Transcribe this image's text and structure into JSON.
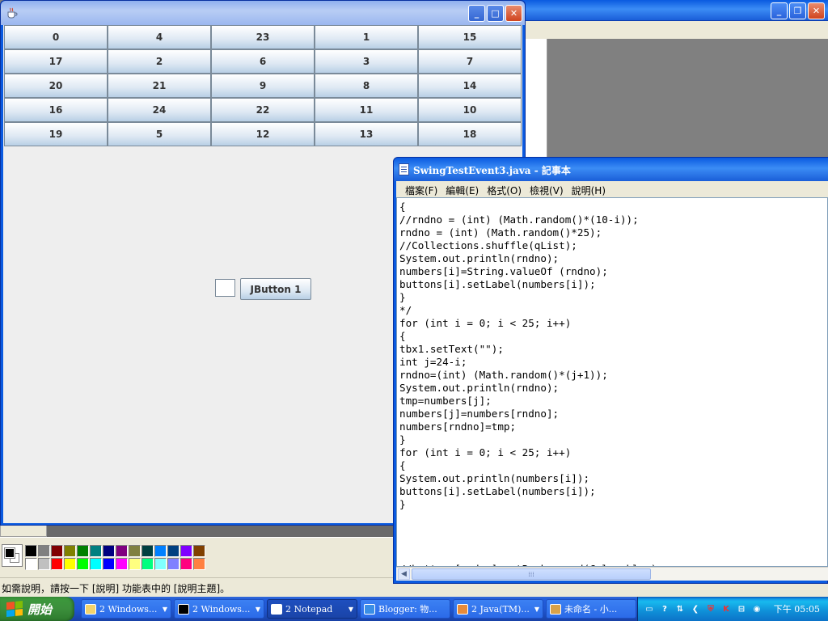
{
  "java_window": {
    "grid_labels": [
      "0",
      "4",
      "23",
      "1",
      "15",
      "17",
      "2",
      "6",
      "3",
      "7",
      "20",
      "21",
      "9",
      "8",
      "14",
      "16",
      "24",
      "22",
      "11",
      "10",
      "19",
      "5",
      "12",
      "13",
      "18"
    ],
    "textbox_value": "",
    "jbutton_label": "JButton 1"
  },
  "notepad": {
    "title": "SwingTestEvent3.java - 記事本",
    "menu": [
      "檔案(F)",
      "編輯(E)",
      "格式(O)",
      "檢視(V)",
      "說明(H)"
    ],
    "code_lines": [
      "{",
      "//rndno = (int) (Math.random()*(10-i));",
      "rndno = (int) (Math.random()*25);",
      "//Collections.shuffle(qList);",
      "System.out.println(rndno);",
      "numbers[i]=String.valueOf (rndno);",
      "buttons[i].setLabel(numbers[i]);",
      "}",
      "*/",
      "for (int i = 0; i < 25; i++)",
      "{",
      "tbx1.setText(\"\");",
      "int j=24-i;",
      "rndno=(int) (Math.random()*(j+1));",
      "System.out.println(rndno);",
      "tmp=numbers[j];",
      "numbers[j]=numbers[rndno];",
      "numbers[rndno]=tmp;",
      "}",
      "for (int i = 0; i < 25; i++)",
      "{",
      "System.out.println(numbers[i]);",
      "buttons[i].setLabel(numbers[i]);",
      "}",
      "",
      "",
      "",
      "",
      "//buttons[rndno].setBackground(Color.blue);"
    ]
  },
  "paint": {
    "status_text": "如需說明，請按一下 [說明] 功能表中的 [說明主題]。",
    "palette_top": [
      "#000000",
      "#808080",
      "#800000",
      "#808000",
      "#008000",
      "#008080",
      "#000080",
      "#800080",
      "#808040",
      "#004040",
      "#0080ff",
      "#004080",
      "#8000ff",
      "#804000"
    ],
    "palette_bottom": [
      "#ffffff",
      "#c0c0c0",
      "#ff0000",
      "#ffff00",
      "#00ff00",
      "#00ffff",
      "#0000ff",
      "#ff00ff",
      "#ffff80",
      "#00ff80",
      "#80ffff",
      "#8080ff",
      "#ff0080",
      "#ff8040"
    ]
  },
  "taskbar": {
    "start_label": "開始",
    "tasks": [
      {
        "label": "2 Windows...",
        "icon": "folder-icon",
        "active": false
      },
      {
        "label": "2 Windows...",
        "icon": "cmd-icon",
        "active": false
      },
      {
        "label": "2 Notepad",
        "icon": "notepad-icon",
        "active": true
      },
      {
        "label": "Blogger: 物...",
        "icon": "ie-icon",
        "active": false
      },
      {
        "label": "2 Java(TM)...",
        "icon": "java-icon",
        "active": false
      },
      {
        "label": "未命名 - 小...",
        "icon": "paint-icon",
        "active": false
      }
    ],
    "clock": "下午 05:05"
  }
}
